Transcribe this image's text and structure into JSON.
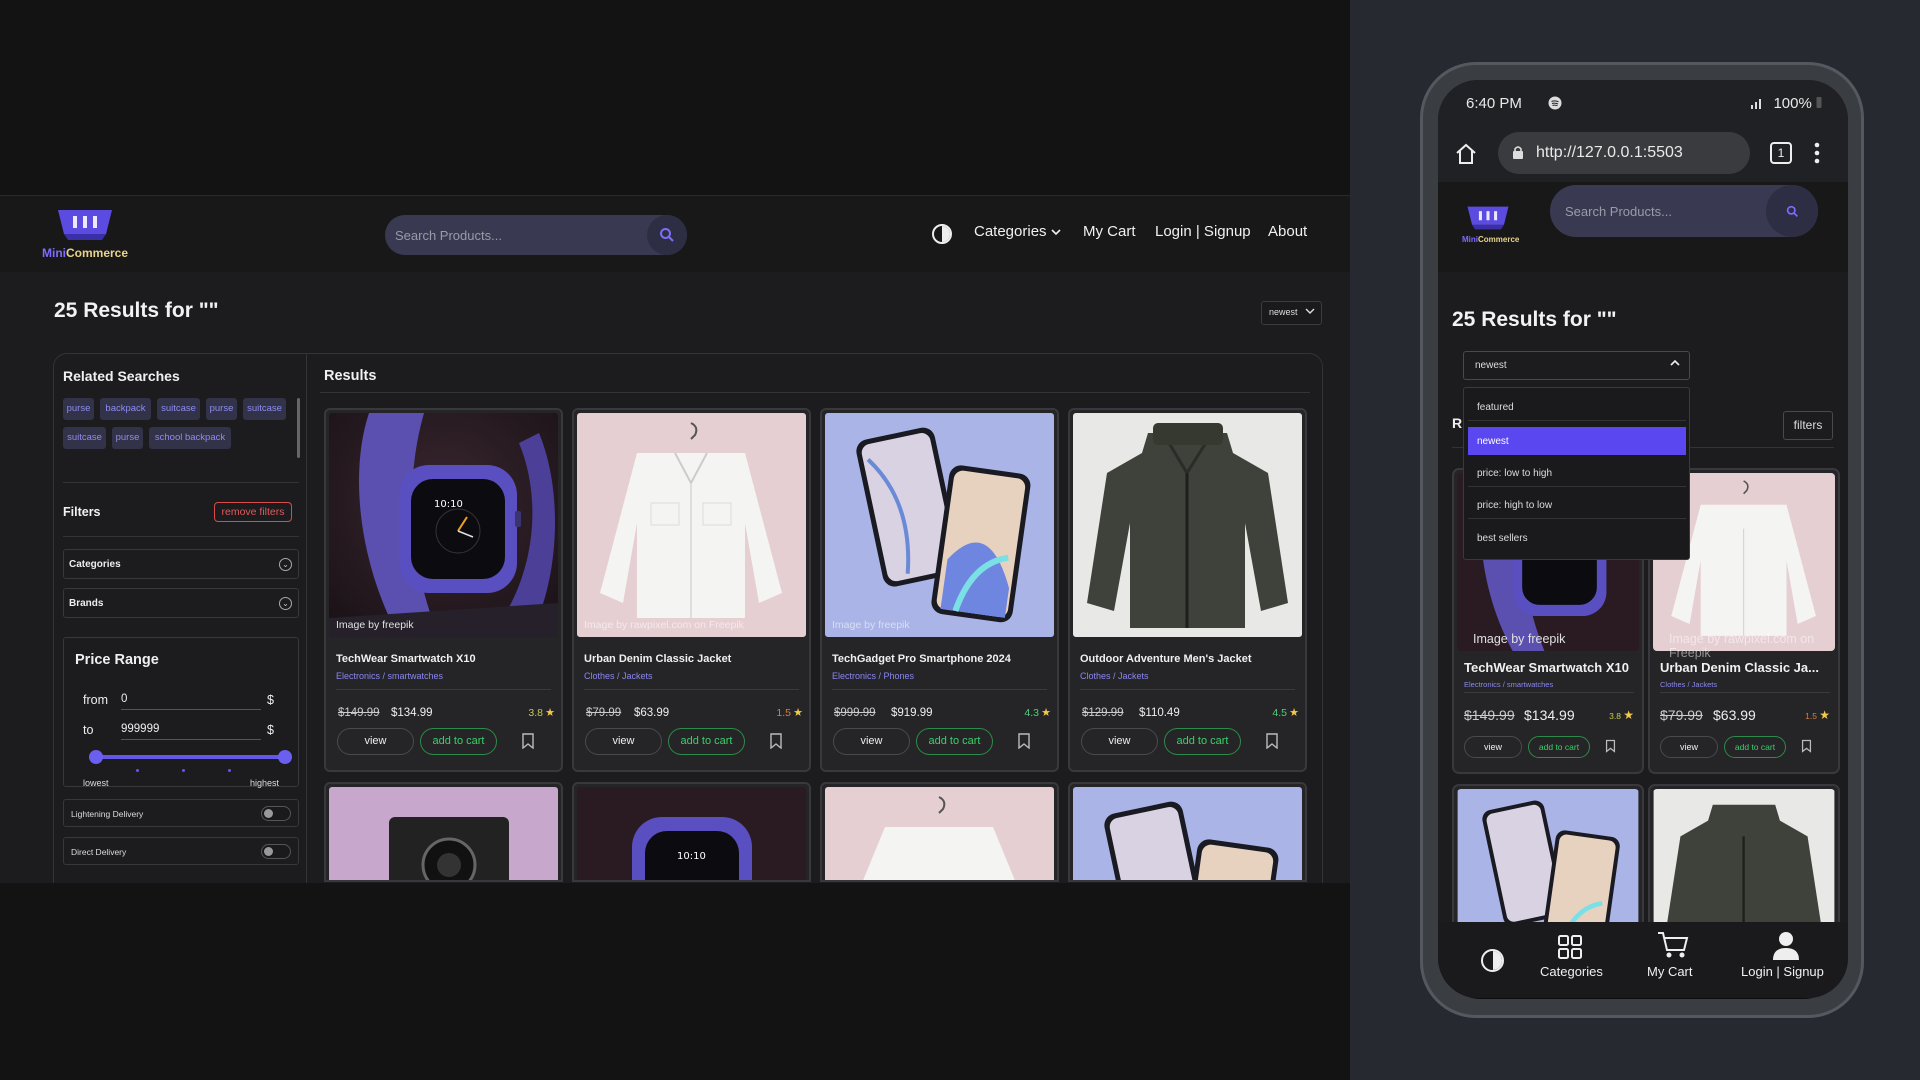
{
  "brand": {
    "mini": "Mini",
    "commerce": "Commerce",
    "accent": "#6257e6"
  },
  "header": {
    "search_placeholder": "Search Products...",
    "nav": {
      "categories": "Categories",
      "cart": "My Cart",
      "login": "Login | Signup",
      "about": "About"
    }
  },
  "results": {
    "title": "25 Results for \"\"",
    "sort_value": "newest",
    "section_title": "Results"
  },
  "sidebar": {
    "related_title": "Related Searches",
    "chips": [
      "purse",
      "backpack",
      "suitcase",
      "purse",
      "suitcase",
      "suitcase",
      "purse",
      "school backpack"
    ],
    "filters_title": "Filters",
    "remove_filters": "remove filters",
    "categories": "Categories",
    "brands": "Brands",
    "price": {
      "title": "Price Range",
      "from_label": "from",
      "from_value": "0",
      "to_label": "to",
      "to_value": "999999",
      "currency": "$",
      "lowest": "lowest",
      "highest": "highest"
    },
    "toggles": [
      "Lightening Delivery",
      "Direct Delivery"
    ]
  },
  "products": [
    {
      "title": "TechWear Smartwatch X10",
      "category": "Electronics / smartwatches",
      "old_price": "$149.99",
      "price": "$134.99",
      "rating": "3.8",
      "rating_color": "#c9c94a",
      "credit": "Image by freepik",
      "image": "watch"
    },
    {
      "title": "Urban Denim Classic Jacket",
      "category": "Clothes / Jackets",
      "old_price": "$79.99",
      "price": "$63.99",
      "rating": "1.5",
      "rating_color": "#e07a3c",
      "credit": "Image by rawpixel.com on Freepik",
      "image": "jacket-white"
    },
    {
      "title": "TechGadget Pro Smartphone 2024",
      "category": "Electronics / Phones",
      "old_price": "$999.99",
      "price": "$919.99",
      "rating": "4.3",
      "rating_color": "#4bd17a",
      "credit": "Image by freepik",
      "image": "phone"
    },
    {
      "title": "Outdoor Adventure Men's Jacket",
      "category": "Clothes / Jackets",
      "old_price": "$129.99",
      "price": "$110.49",
      "rating": "4.5",
      "rating_color": "#4bd17a",
      "credit": "",
      "image": "jacket-dark"
    }
  ],
  "card_actions": {
    "view": "view",
    "add_to_cart": "add to cart"
  },
  "mobile": {
    "time": "6:40 PM",
    "battery": "100%",
    "url": "http://127.0.0.1:5503",
    "tab_count": "1",
    "sort_options": [
      "featured",
      "newest",
      "price: low to high",
      "price: high to low",
      "best sellers"
    ],
    "selected_sort": "newest",
    "filters_button": "filters",
    "results_letter": "R",
    "mobile_titles": [
      "TechWear Smartwatch X10",
      "Urban Denim Classic Ja..."
    ],
    "bottom_nav": {
      "categories": "Categories",
      "cart": "My Cart",
      "login": "Login | Signup"
    }
  }
}
